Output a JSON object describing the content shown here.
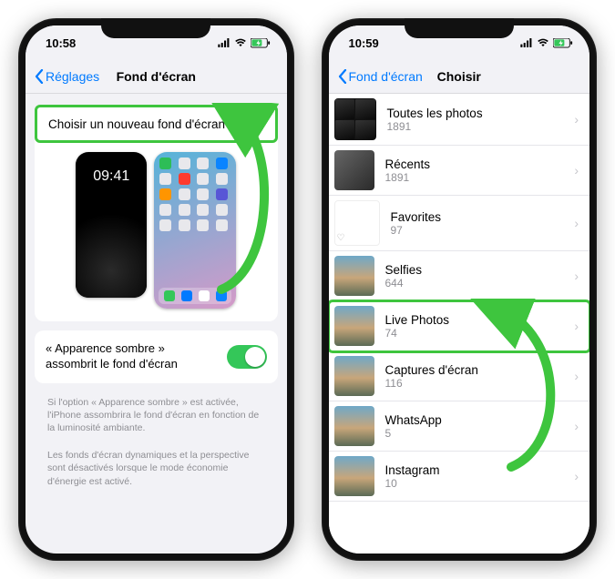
{
  "status": {
    "time1": "10:58",
    "time2": "10:59"
  },
  "nav1": {
    "back": "Réglages",
    "title": "Fond d'écran"
  },
  "nav2": {
    "back": "Fond d'écran",
    "title": "Choisir"
  },
  "choose_new": "Choisir un nouveau fond d'écran",
  "lock_clock": "09:41",
  "dark_appearance": "« Apparence sombre » assombrit le fond d'écran",
  "footer1": "Si l'option « Apparence sombre » est activée, l'iPhone assombrira le fond d'écran en fonction de la luminosité ambiante.",
  "footer2": "Les fonds d'écran dynamiques et la perspective sont désactivés lorsque le mode économie d'énergie est activé.",
  "albums": [
    {
      "title": "Toutes les photos",
      "count": "1891"
    },
    {
      "title": "Récents",
      "count": "1891"
    },
    {
      "title": "Favorites",
      "count": "97"
    },
    {
      "title": "Selfies",
      "count": "644"
    },
    {
      "title": "Live Photos",
      "count": "74"
    },
    {
      "title": "Captures d'écran",
      "count": "116"
    },
    {
      "title": "WhatsApp",
      "count": "5"
    },
    {
      "title": "Instagram",
      "count": "10"
    }
  ],
  "highlight_album_index": 4,
  "accent": "#3ec53e"
}
